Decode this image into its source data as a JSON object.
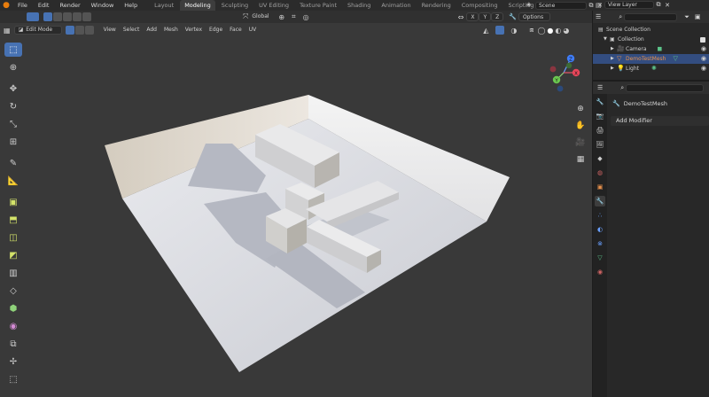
{
  "menu": [
    "File",
    "Edit",
    "Render",
    "Window",
    "Help"
  ],
  "workspaces": [
    "Layout",
    "Modeling",
    "Sculpting",
    "UV Editing",
    "Texture Paint",
    "Shading",
    "Animation",
    "Rendering",
    "Compositing",
    "Scripting"
  ],
  "active_workspace": "Modeling",
  "scene": {
    "label": "Scene"
  },
  "view_layer": {
    "label": "View Layer"
  },
  "tool_header": {
    "orientation": "Global",
    "axes": [
      "X",
      "Y",
      "Z"
    ],
    "options": "Options"
  },
  "viewport_header": {
    "mode": "Edit Mode",
    "menus": [
      "View",
      "Select",
      "Add",
      "Mesh",
      "Vertex",
      "Edge",
      "Face",
      "UV"
    ]
  },
  "gizmo": {
    "x": "X",
    "y": "Y",
    "z": "Z"
  },
  "outliner": {
    "root": "Scene Collection",
    "collection": "Collection",
    "items": [
      {
        "name": "Camera",
        "icon": "camera-icon",
        "selected": false
      },
      {
        "name": "DemoTestMesh",
        "icon": "mesh-icon",
        "selected": true
      },
      {
        "name": "Light",
        "icon": "light-icon",
        "selected": false
      }
    ]
  },
  "properties": {
    "object_name": "DemoTestMesh",
    "add_modifier": "Add Modifier"
  },
  "colors": {
    "accent": "#4772b3",
    "selection": "#334d80",
    "viewport_bg": "#393939"
  }
}
